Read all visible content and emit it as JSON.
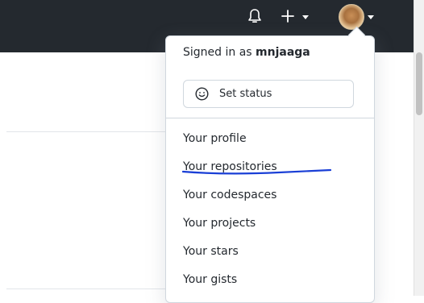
{
  "header": {
    "notifications_icon": "bell-icon",
    "create_icon": "plus-icon",
    "avatar_icon": "avatar"
  },
  "dropdown": {
    "signed_in_prefix": "Signed in as ",
    "username": "mnjaaga",
    "status_label": "Set status",
    "status_icon": "smiley-icon",
    "items": [
      {
        "label": "Your profile"
      },
      {
        "label": "Your repositories"
      },
      {
        "label": "Your codespaces"
      },
      {
        "label": "Your projects"
      },
      {
        "label": "Your stars"
      },
      {
        "label": "Your gists"
      }
    ]
  },
  "colors": {
    "topbar": "#24292f",
    "annotation": "#1a3fd6"
  }
}
